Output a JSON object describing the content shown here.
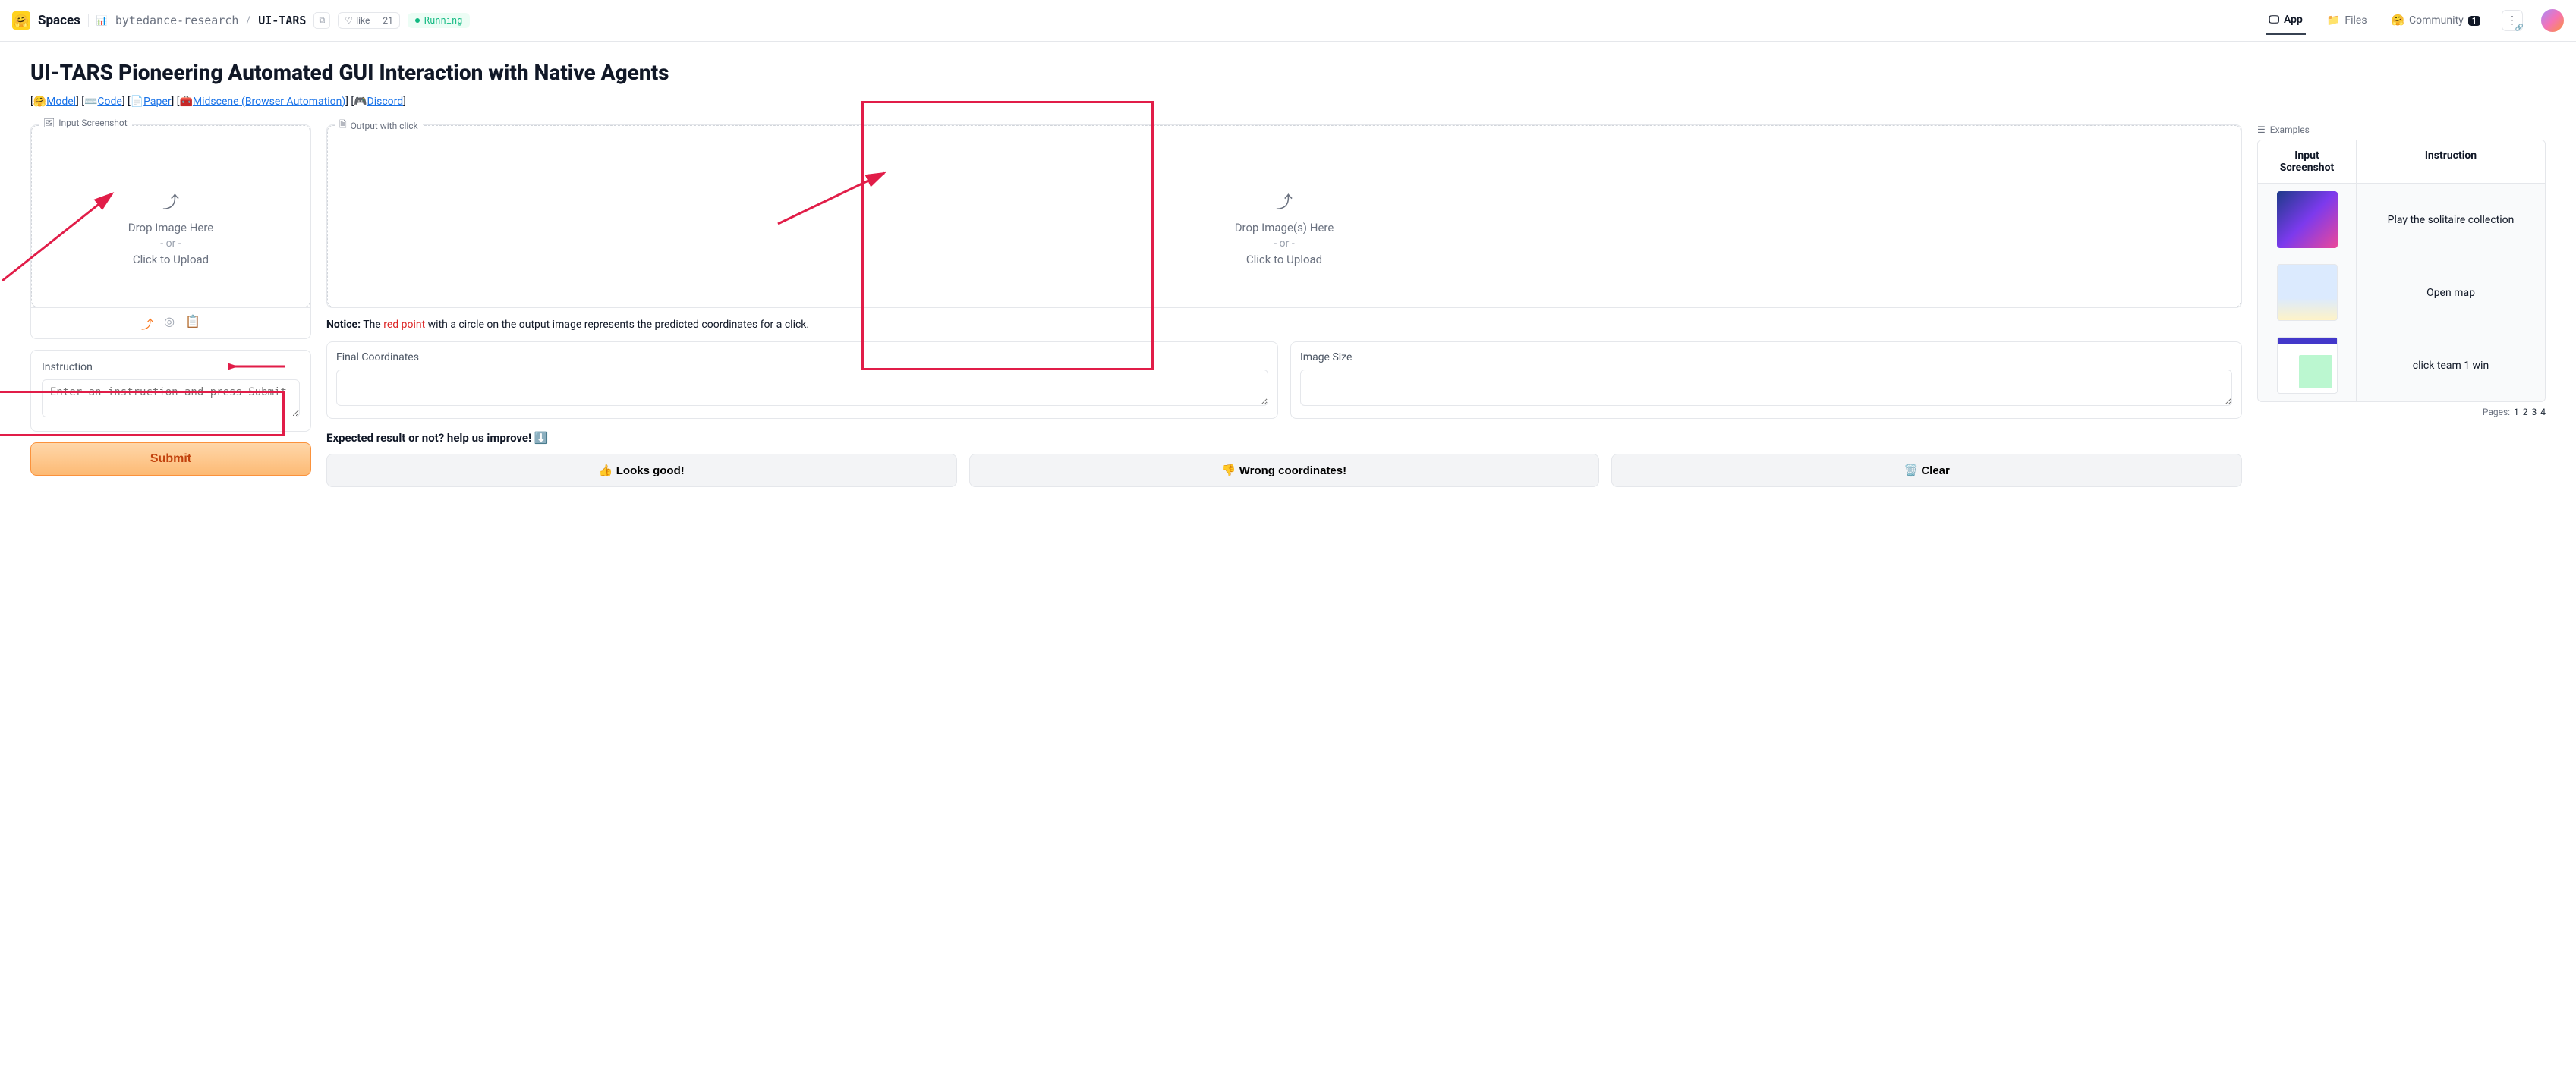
{
  "topbar": {
    "spaces": "Spaces",
    "org": "bytedance-research",
    "space": "UI-TARS",
    "like_label": "like",
    "like_count": "21",
    "status": "Running"
  },
  "nav": {
    "app": "App",
    "files": "Files",
    "community": "Community",
    "community_count": "1"
  },
  "title": "UI-TARS Pioneering Automated GUI Interaction with Native Agents",
  "links": {
    "model": "Model",
    "code": "Code",
    "paper": "Paper",
    "midscene": "Midscene (Browser Automation)",
    "discord": "Discord"
  },
  "input_panel": {
    "label": "Input Screenshot",
    "drop": "Drop Image Here",
    "or": "- or -",
    "click": "Click to Upload"
  },
  "output_panel": {
    "label": "Output with click",
    "drop": "Drop Image(s) Here",
    "or": "- or -",
    "click": "Click to Upload"
  },
  "instruction": {
    "label": "Instruction",
    "placeholder": "Enter an instruction and press Submit"
  },
  "submit": "Submit",
  "notice": {
    "prefix": "Notice:",
    "t1": " The ",
    "red": "red point",
    "t2": " with a circle on the output image represents the predicted coordinates for a click."
  },
  "coords_label": "Final Coordinates",
  "size_label": "Image Size",
  "expected": "Expected result or not? help us improve! ",
  "feedback": {
    "good": "👍 Looks good!",
    "wrong": "👎 Wrong coordinates!",
    "clear": "🗑️ Clear"
  },
  "examples": {
    "header": "Examples",
    "col1": "Input Screenshot",
    "col2": "Instruction",
    "rows": [
      {
        "instr": "Play the solitaire collection"
      },
      {
        "instr": "Open map"
      },
      {
        "instr": "click team 1 win"
      }
    ],
    "pages_label": "Pages:",
    "pages": [
      "1",
      "2",
      "3",
      "4"
    ]
  }
}
